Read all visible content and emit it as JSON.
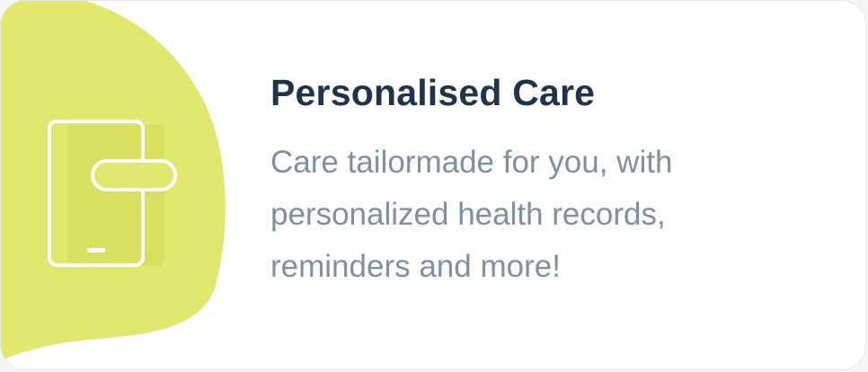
{
  "card": {
    "title": "Personalised Care",
    "description": "Care tailormade for you, with personalized health records, reminders and more!",
    "icon": "mobile-device-icon",
    "colors": {
      "accent_blob": "#e2e86e",
      "title": "#1f3349",
      "description": "#7f90a4",
      "icon_stroke": "#ffffff"
    }
  }
}
